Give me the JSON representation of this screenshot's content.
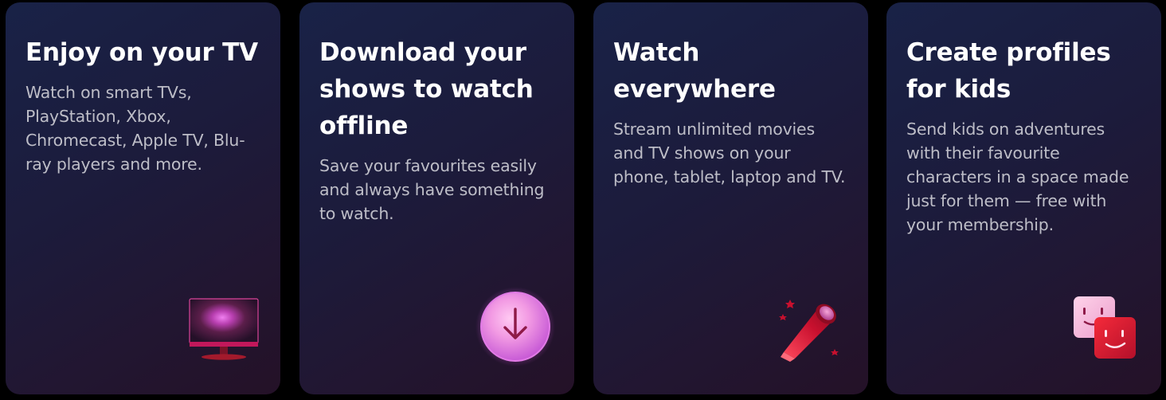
{
  "features": [
    {
      "title": "Enjoy on your TV",
      "description": "Watch on smart TVs, PlayStation, Xbox, Chromecast, Apple TV, Blu-ray players and more.",
      "icon": "tv-icon"
    },
    {
      "title": "Download your shows to watch offline",
      "description": "Save your favourites easily and always have something to watch.",
      "icon": "download-icon"
    },
    {
      "title": "Watch everywhere",
      "description": "Stream unlimited movies and TV shows on your phone, tablet, laptop and TV.",
      "icon": "telescope-icon"
    },
    {
      "title": "Create profiles for kids",
      "description": "Send kids on adventures with their favourite characters in a space made just for them — free with your membership.",
      "icon": "kids-profile-icon"
    }
  ],
  "colors": {
    "brand_red": "#e50914",
    "accent_pink": "#e07be0",
    "accent_magenta": "#c2185b"
  }
}
